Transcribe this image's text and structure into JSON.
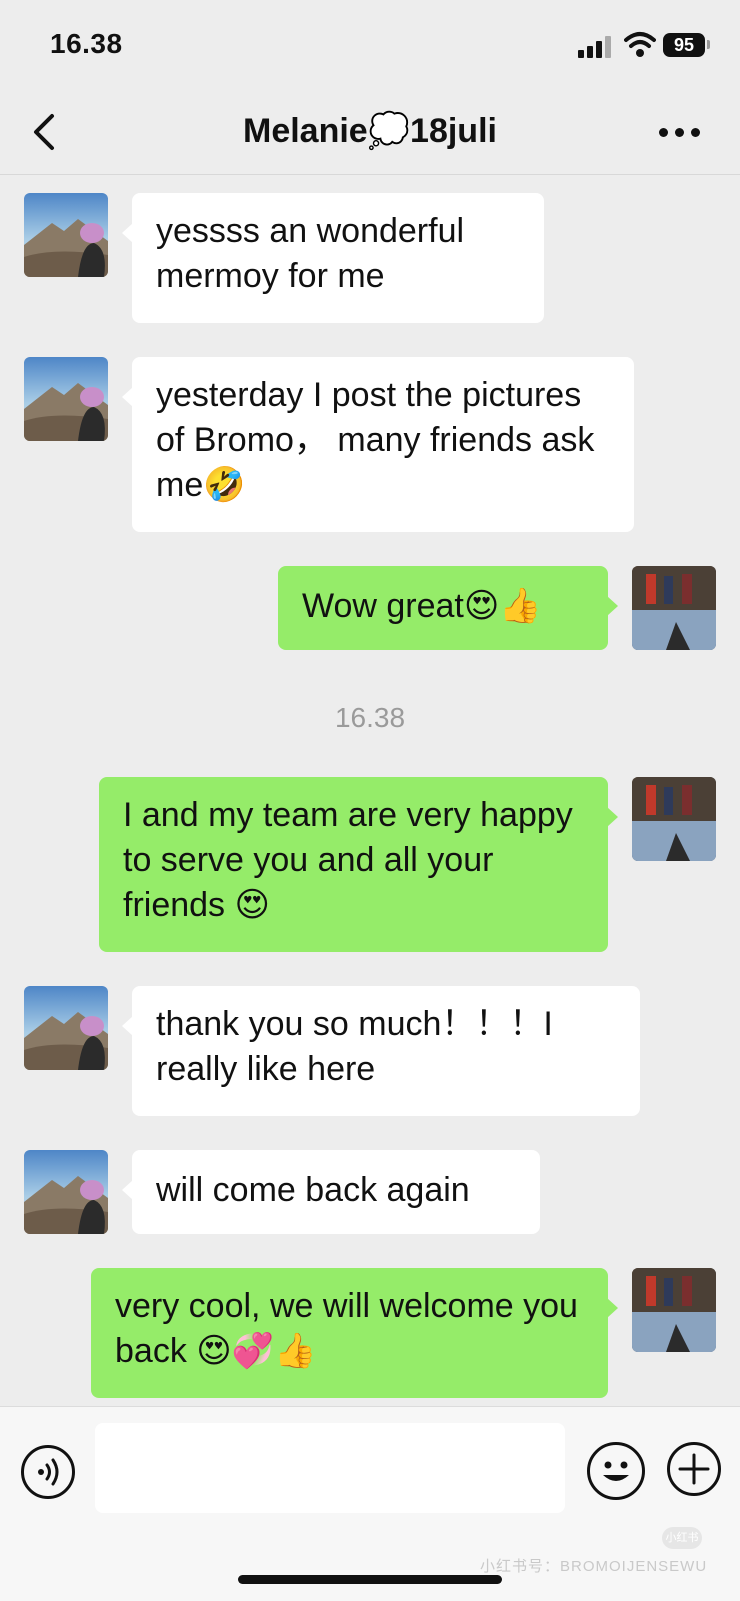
{
  "status_bar": {
    "time": "16.38",
    "battery": "95",
    "icons": [
      "signal-icon",
      "wifi-icon",
      "battery-icon"
    ]
  },
  "header": {
    "back_icon": "chevron-left-icon",
    "title": "Melanie💭18juli",
    "more_icon": "more-icon"
  },
  "messages": [
    {
      "side": "in",
      "text": "yessss an wonderful mermoy for me"
    },
    {
      "side": "in",
      "text": "yesterday I post the pictures of Bromo，  many friends ask me🤣"
    },
    {
      "side": "out",
      "text": "Wow great😍👍"
    },
    {
      "side": "out",
      "text": "I and my team are very happy to serve you and all your friends 😍"
    },
    {
      "side": "in",
      "text": "thank you so much！！！I really like here"
    },
    {
      "side": "in",
      "text": "will come back again"
    },
    {
      "side": "out",
      "text": "very cool, we will welcome you back 😍💞👍"
    }
  ],
  "timestamp": "16.38",
  "input_bar": {
    "voice_icon": "voice-icon",
    "text_value": "",
    "emoji_icon": "emoji-icon",
    "plus_icon": "plus-icon"
  },
  "watermark": {
    "badge": "小红书",
    "text": "小红书号：BROMOIJENSEWU"
  },
  "colors": {
    "background": "#ededed",
    "incoming_bubble": "#ffffff",
    "outgoing_bubble": "#95ec69"
  }
}
